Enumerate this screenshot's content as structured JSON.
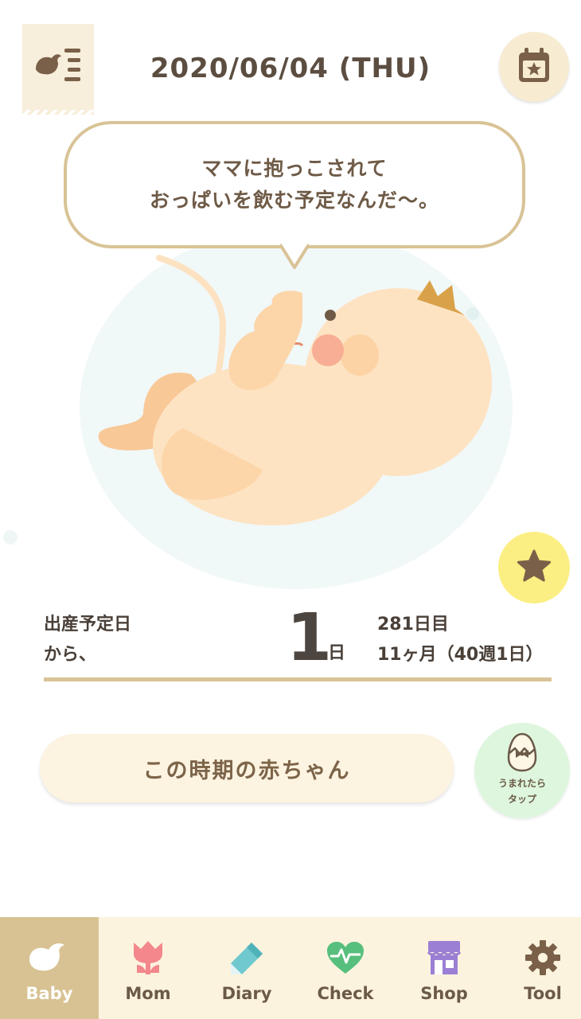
{
  "header": {
    "date": "2020/06/04 (THU)",
    "menu_icon": "bird-menu-icon",
    "calendar_icon": "calendar-star-icon"
  },
  "bubble": {
    "line1": "ママに抱っこされて",
    "line2": "おっぱいを飲む予定なんだ〜。"
  },
  "illustration": "baby-in-womb",
  "stats": {
    "label_line1": "出産予定日",
    "label_line2": "から、",
    "days": "1",
    "unit": "日",
    "day_count": "281日目",
    "month_week": "11ヶ月（40週1日）"
  },
  "actions": {
    "this_period_button": "この時期の赤ちゃん",
    "born_line1": "うまれたら",
    "born_line2": "タップ"
  },
  "nav": {
    "tabs": [
      {
        "label": "Baby",
        "icon": "bird-icon"
      },
      {
        "label": "Mom",
        "icon": "tulip-icon"
      },
      {
        "label": "Diary",
        "icon": "pencil-icon"
      },
      {
        "label": "Check",
        "icon": "heartbeat-icon"
      },
      {
        "label": "Shop",
        "icon": "shop-icon"
      },
      {
        "label": "Tool",
        "icon": "gear-icon"
      }
    ],
    "active": "Baby"
  },
  "colors": {
    "accent": "#d8c293",
    "bubble_border": "#d9c396",
    "favorite": "#fbef83",
    "born_button": "#def6de",
    "tabbar": "#fcf3de"
  }
}
